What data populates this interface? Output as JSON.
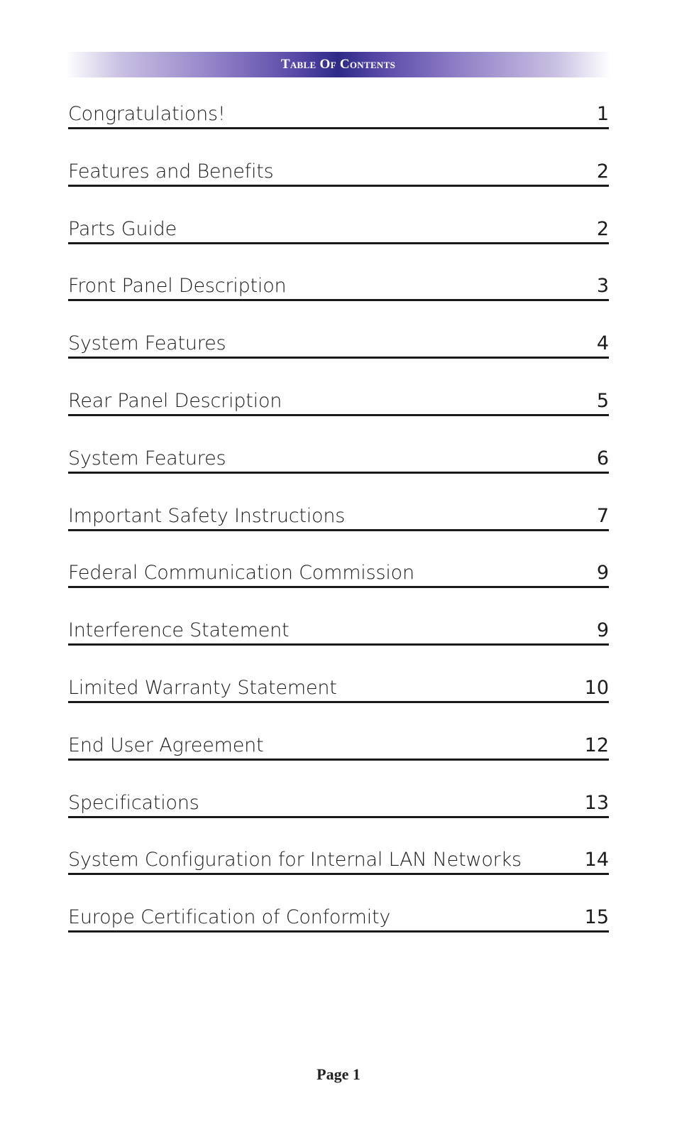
{
  "header": {
    "title": "Table Of Contents"
  },
  "toc": {
    "entries": [
      {
        "label": "Congratulations!",
        "page": "1"
      },
      {
        "label": "Features and Benefits",
        "page": "2"
      },
      {
        "label": "Parts Guide",
        "page": "2"
      },
      {
        "label": "Front Panel Description",
        "page": "3"
      },
      {
        "label": "System Features",
        "page": "4"
      },
      {
        "label": "Rear Panel Description",
        "page": "5"
      },
      {
        "label": "System Features",
        "page": "6"
      },
      {
        "label": "Important Safety Instructions",
        "page": "7"
      },
      {
        "label": "Federal Communication Commission",
        "page": "9"
      },
      {
        "label": "Interference Statement",
        "page": "9"
      },
      {
        "label": "Limited Warranty Statement",
        "page": "10"
      },
      {
        "label": "End User Agreement",
        "page": "12"
      },
      {
        "label": "Specifications",
        "page": "13"
      },
      {
        "label": "System Configuration for Internal LAN Networks",
        "page": "14"
      },
      {
        "label": "Europe Certification of Conformity",
        "page": "15"
      }
    ]
  },
  "footer": {
    "page_label": "Page 1"
  },
  "colors": {
    "banner_center": "#2e2a88",
    "banner_text": "#ffffff",
    "rule": "#1a1a1a"
  }
}
